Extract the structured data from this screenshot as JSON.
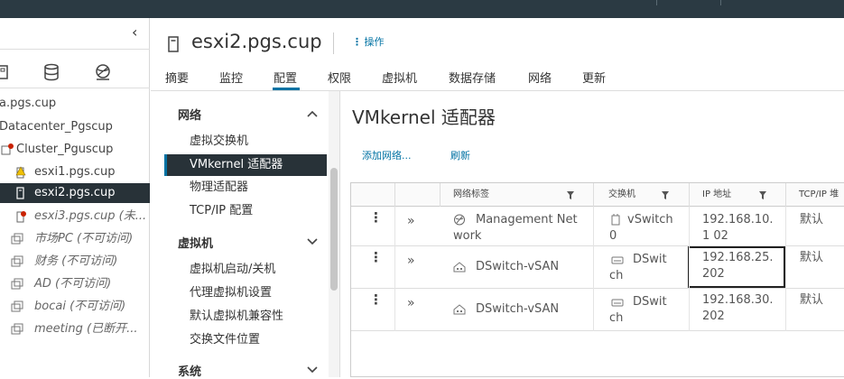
{
  "tree": {
    "collapse_glyph": "‹",
    "nodes": [
      {
        "label": "a.pgs.cup",
        "italic": false,
        "icon": "vcenter-icon"
      },
      {
        "label": "Datacenter_Pgscup",
        "italic": false,
        "icon": "datacenter-icon"
      },
      {
        "label": "Cluster_Pguscup",
        "italic": false,
        "icon": "cluster-alert-icon"
      },
      {
        "label": "esxi1.pgs.cup",
        "italic": false,
        "icon": "host-warning-icon"
      },
      {
        "label": "esxi2.pgs.cup",
        "italic": false,
        "icon": "host-icon",
        "selected": true
      },
      {
        "label": "esxi3.pgs.cup (未...",
        "italic": true,
        "icon": "host-error-icon"
      },
      {
        "label": "市场PC (不可访问)",
        "italic": true,
        "icon": "vm-icon"
      },
      {
        "label": "财务 (不可访问)",
        "italic": true,
        "icon": "vm-icon"
      },
      {
        "label": "AD (不可访问)",
        "italic": true,
        "icon": "vm-icon"
      },
      {
        "label": "bocai (不可访问)",
        "italic": true,
        "icon": "vm-icon"
      },
      {
        "label": "meeting (已断开...",
        "italic": true,
        "icon": "vm-icon"
      }
    ]
  },
  "header": {
    "title": "esxi2.pgs.cup",
    "actions_label": "操作",
    "tabs": [
      "摘要",
      "监控",
      "配置",
      "权限",
      "虚拟机",
      "数据存储",
      "网络",
      "更新"
    ],
    "active_tab": "配置"
  },
  "config_nav": {
    "groups": [
      {
        "label": "网络",
        "items": [
          "虚拟交换机",
          "VMkernel 适配器",
          "物理适配器",
          "TCP/IP 配置"
        ]
      },
      {
        "label": "虚拟机",
        "items": [
          "虚拟机启动/关机",
          "代理虚拟机设置",
          "默认虚拟机兼容性",
          "交换文件位置"
        ]
      },
      {
        "label": "系统",
        "items": []
      }
    ],
    "selected": "VMkernel 适配器"
  },
  "main": {
    "title": "VMkernel 适配器",
    "add_network_label": "添加网络...",
    "refresh_label": "刷新",
    "columns": [
      "网络标签",
      "交换机",
      "IP 地址",
      "TCP/IP 堆"
    ],
    "rows": [
      {
        "network": "Management Net work",
        "switch": "vSwitch 0",
        "ip": "192.168.10.1 02",
        "tcpip": "默认",
        "net_icon": "management-network-icon",
        "sw_icon": "standard-switch-icon"
      },
      {
        "network": "DSwitch-vSAN",
        "switch": "DSwit ch",
        "ip": "192.168.25. 202",
        "tcpip": "默认",
        "net_icon": "distributed-portgroup-icon",
        "sw_icon": "distributed-switch-icon",
        "selected_cell": true
      },
      {
        "network": "DSwitch-vSAN",
        "switch": "DSwit ch",
        "ip": "192.168.30. 202",
        "tcpip": "默认",
        "net_icon": "distributed-portgroup-icon",
        "sw_icon": "distributed-switch-icon"
      }
    ]
  },
  "colors": {
    "accent": "#0072a3",
    "selected_bg": "#283238",
    "topbar": "#2b3a43"
  }
}
